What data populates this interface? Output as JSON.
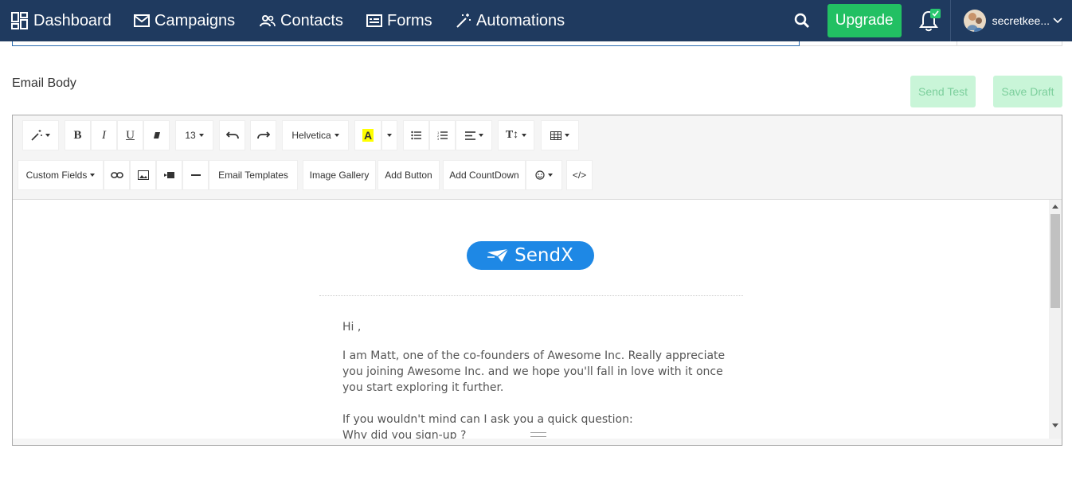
{
  "nav": {
    "items": [
      {
        "label": "Dashboard",
        "icon": "dashboard-icon"
      },
      {
        "label": "Campaigns",
        "icon": "envelope-icon"
      },
      {
        "label": "Contacts",
        "icon": "people-icon"
      },
      {
        "label": "Forms",
        "icon": "form-icon"
      },
      {
        "label": "Automations",
        "icon": "magic-wand-icon"
      }
    ],
    "upgrade_label": "Upgrade",
    "username": "secretkee..."
  },
  "email_body": {
    "label": "Email Body",
    "send_test_label": "Send Test",
    "save_draft_label": "Save Draft"
  },
  "toolbar": {
    "font_size": "13",
    "font_family": "Helvetica",
    "custom_fields_label": "Custom Fields",
    "email_templates_label": "Email Templates",
    "image_gallery_label": "Image Gallery",
    "add_button_label": "Add Button",
    "add_countdown_label": "Add CountDown",
    "code_view_label": "</>"
  },
  "content": {
    "logo_text": "SendX",
    "greeting": "Hi ,",
    "para1": "I am Matt, one of the co-founders of Awesome Inc. Really appreciate you joining Awesome Inc. and we hope you'll fall in love with it once you start exploring it further.",
    "para2_line1": "If you wouldn't mind can I ask you a quick question:",
    "para2_line2": "Why did you sign-up ?"
  },
  "colors": {
    "nav_bg": "#1f3a5f",
    "upgrade_green": "#22c063",
    "logo_blue": "#1e88e5",
    "light_green_btn": "#c9f5d8"
  }
}
